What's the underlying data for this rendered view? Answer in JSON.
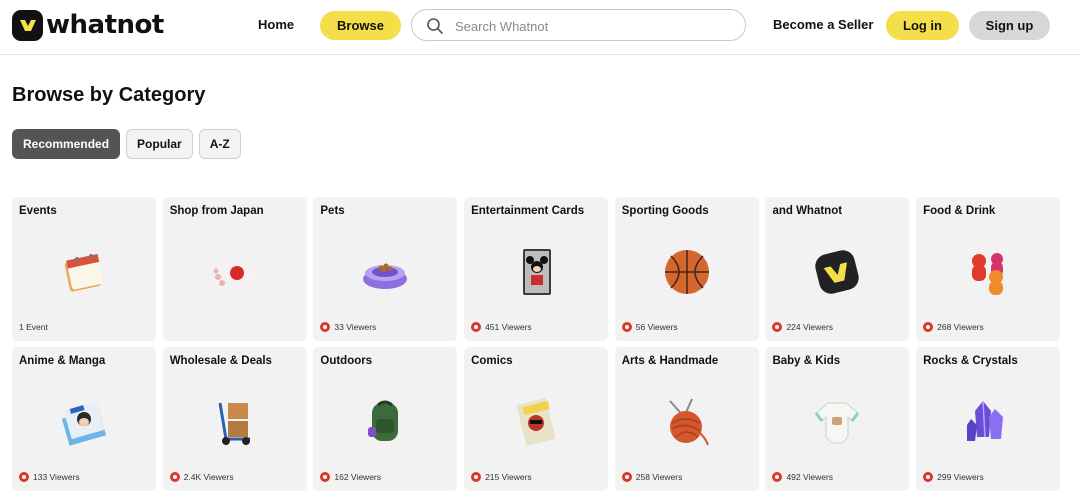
{
  "header": {
    "logo_text": "whatnot",
    "home_label": "Home",
    "browse_label": "Browse",
    "search_placeholder": "Search Whatnot",
    "become_seller_label": "Become a Seller",
    "login_label": "Log in",
    "signup_label": "Sign up"
  },
  "main": {
    "title": "Browse by Category",
    "filters": [
      {
        "label": "Recommended",
        "active": true
      },
      {
        "label": "Popular",
        "active": false
      },
      {
        "label": "A-Z",
        "active": false
      }
    ],
    "categories": [
      {
        "name": "Events",
        "meta": "1 Event",
        "live": false,
        "icon": "calendar-icon"
      },
      {
        "name": "Shop from Japan",
        "meta": "",
        "live": false,
        "icon": "japan-flag-icon"
      },
      {
        "name": "Pets",
        "meta": "33 Viewers",
        "live": true,
        "icon": "pet-bowl-icon"
      },
      {
        "name": "Entertainment Cards",
        "meta": "451 Viewers",
        "live": true,
        "icon": "trading-card-icon"
      },
      {
        "name": "Sporting Goods",
        "meta": "56 Viewers",
        "live": true,
        "icon": "basketball-icon"
      },
      {
        "name": "and Whatnot",
        "meta": "224 Viewers",
        "live": true,
        "icon": "whatnot-logo-icon"
      },
      {
        "name": "Food & Drink",
        "meta": "268 Viewers",
        "live": true,
        "icon": "gummy-bears-icon"
      },
      {
        "name": "Anime & Manga",
        "meta": "133 Viewers",
        "live": true,
        "icon": "manga-books-icon"
      },
      {
        "name": "Wholesale & Deals",
        "meta": "2.4K Viewers",
        "live": true,
        "icon": "hand-truck-icon"
      },
      {
        "name": "Outdoors",
        "meta": "162 Viewers",
        "live": true,
        "icon": "backpack-icon"
      },
      {
        "name": "Comics",
        "meta": "215 Viewers",
        "live": true,
        "icon": "comic-book-icon"
      },
      {
        "name": "Arts & Handmade",
        "meta": "258 Viewers",
        "live": true,
        "icon": "yarn-ball-icon"
      },
      {
        "name": "Baby & Kids",
        "meta": "492 Viewers",
        "live": true,
        "icon": "onesie-icon"
      },
      {
        "name": "Rocks & Crystals",
        "meta": "299 Viewers",
        "live": true,
        "icon": "crystal-icon"
      }
    ]
  },
  "colors": {
    "brand_yellow": "#f4df4a",
    "live_red": "#d9382b",
    "card_bg": "#f2f2f2",
    "active_chip": "#545454"
  }
}
